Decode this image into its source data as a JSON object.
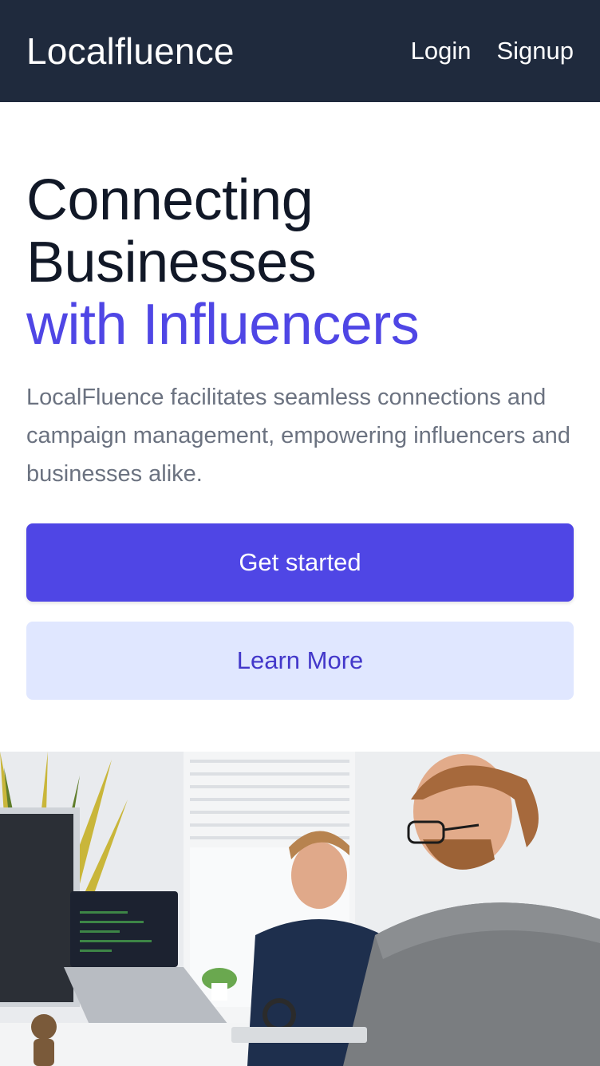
{
  "header": {
    "brand": "Localfluence",
    "nav": [
      {
        "label": "Login"
      },
      {
        "label": "Signup"
      }
    ]
  },
  "hero": {
    "headline_line1": "Connecting",
    "headline_line2": "Businesses",
    "headline_accent": "with Influencers",
    "description": "LocalFluence facilitates seamless connections and campaign management, empowering influencers and businesses alike.",
    "primary_button": "Get started",
    "secondary_button": "Learn More"
  },
  "colors": {
    "header_bg": "#1f2a3d",
    "accent": "#4f46e5",
    "secondary_bg": "#e0e7ff",
    "secondary_text": "#4338ca"
  }
}
